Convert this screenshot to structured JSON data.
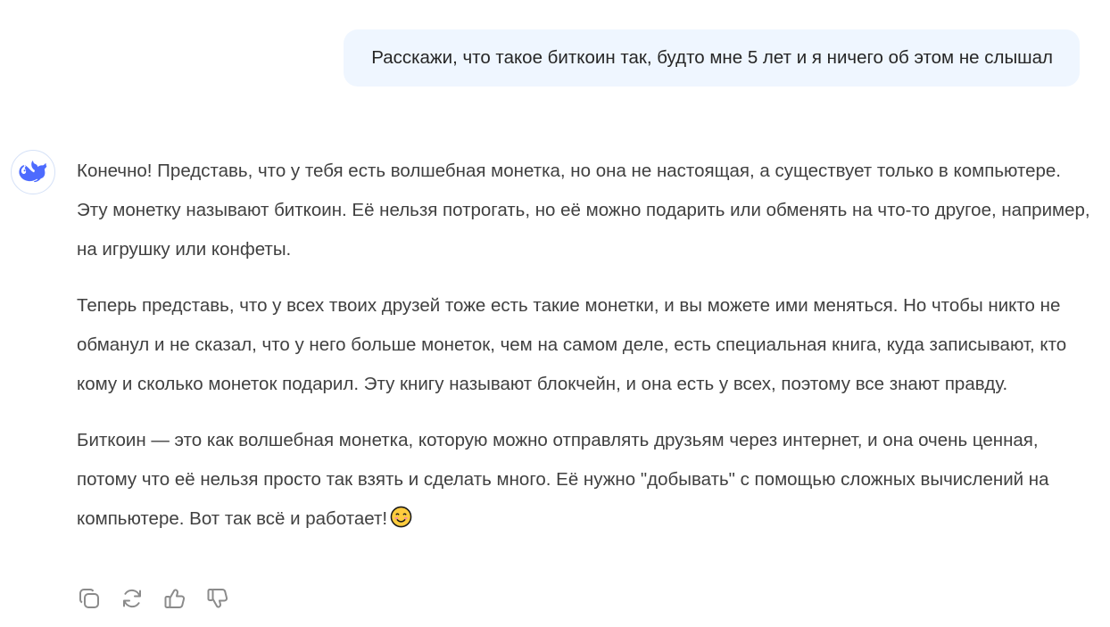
{
  "user_message": {
    "text": "Расскажи, что такое биткоин так, будто мне 5 лет и я ничего об этом не слышал"
  },
  "assistant": {
    "avatar_icon": "whale-logo-icon",
    "accent_color": "#4d6bfe",
    "paragraphs": [
      "Конечно! Представь, что у тебя есть волшебная монетка, но она не настоящая, а существует только в компьютере. Эту монетку называют биткоин. Её нельзя потрогать, но её можно подарить или обменять на что-то другое, например, на игрушку или конфеты.",
      "Теперь представь, что у всех твоих друзей тоже есть такие монетки, и вы можете ими меняться. Но чтобы никто не обманул и не сказал, что у него больше монеток, чем на самом деле, есть специальная книга, куда записывают, кто кому и сколько монеток подарил. Эту книгу называют блокчейн, и она есть у всех, поэтому все знают правду.",
      "Биткоин — это как волшебная монетка, которую можно отправлять друзьям через интернет, и она очень ценная, потому что её нельзя просто так взять и сделать много. Её нужно \"добывать\" с помощью сложных вычислений на компьютере. Вот так всё и работает!"
    ],
    "emoji_icon": "smiling-face-icon"
  },
  "actions": [
    {
      "name": "copy-button",
      "icon": "copy-icon"
    },
    {
      "name": "regenerate-button",
      "icon": "refresh-icon"
    },
    {
      "name": "like-button",
      "icon": "thumbs-up-icon"
    },
    {
      "name": "dislike-button",
      "icon": "thumbs-down-icon"
    }
  ],
  "colors": {
    "user_bubble_bg": "#eff6ff",
    "text": "#404040",
    "icon": "#8b8b8b"
  }
}
